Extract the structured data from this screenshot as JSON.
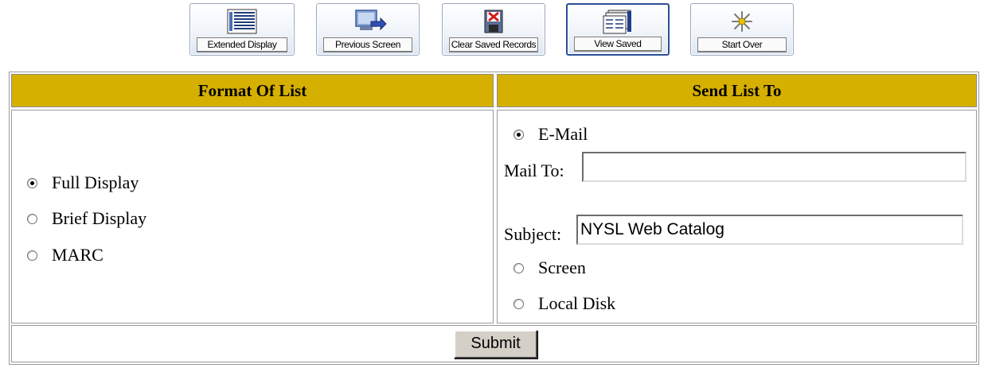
{
  "toolbar": {
    "buttons": [
      {
        "label": "Extended Display",
        "icon": "extended-display-icon"
      },
      {
        "label": "Previous Screen",
        "icon": "previous-screen-icon"
      },
      {
        "label": "Clear Saved Records",
        "icon": "clear-saved-records-icon"
      },
      {
        "label": "View Saved",
        "icon": "view-saved-icon"
      },
      {
        "label": "Start Over",
        "icon": "start-over-icon"
      }
    ]
  },
  "format": {
    "header": "Format Of List",
    "options": [
      {
        "label": "Full Display",
        "checked": true
      },
      {
        "label": "Brief Display",
        "checked": false
      },
      {
        "label": "MARC",
        "checked": false
      }
    ]
  },
  "send": {
    "header": "Send List To",
    "email_label": "E-Mail",
    "mail_to_label": "Mail To:",
    "mail_to_value": "",
    "subject_label": "Subject:",
    "subject_value": "NYSL Web Catalog",
    "screen_label": "Screen",
    "local_disk_label": "Local Disk"
  },
  "submit_label": "Submit",
  "colors": {
    "header_bg": "#d6b000",
    "active_border": "#2a4f96"
  }
}
